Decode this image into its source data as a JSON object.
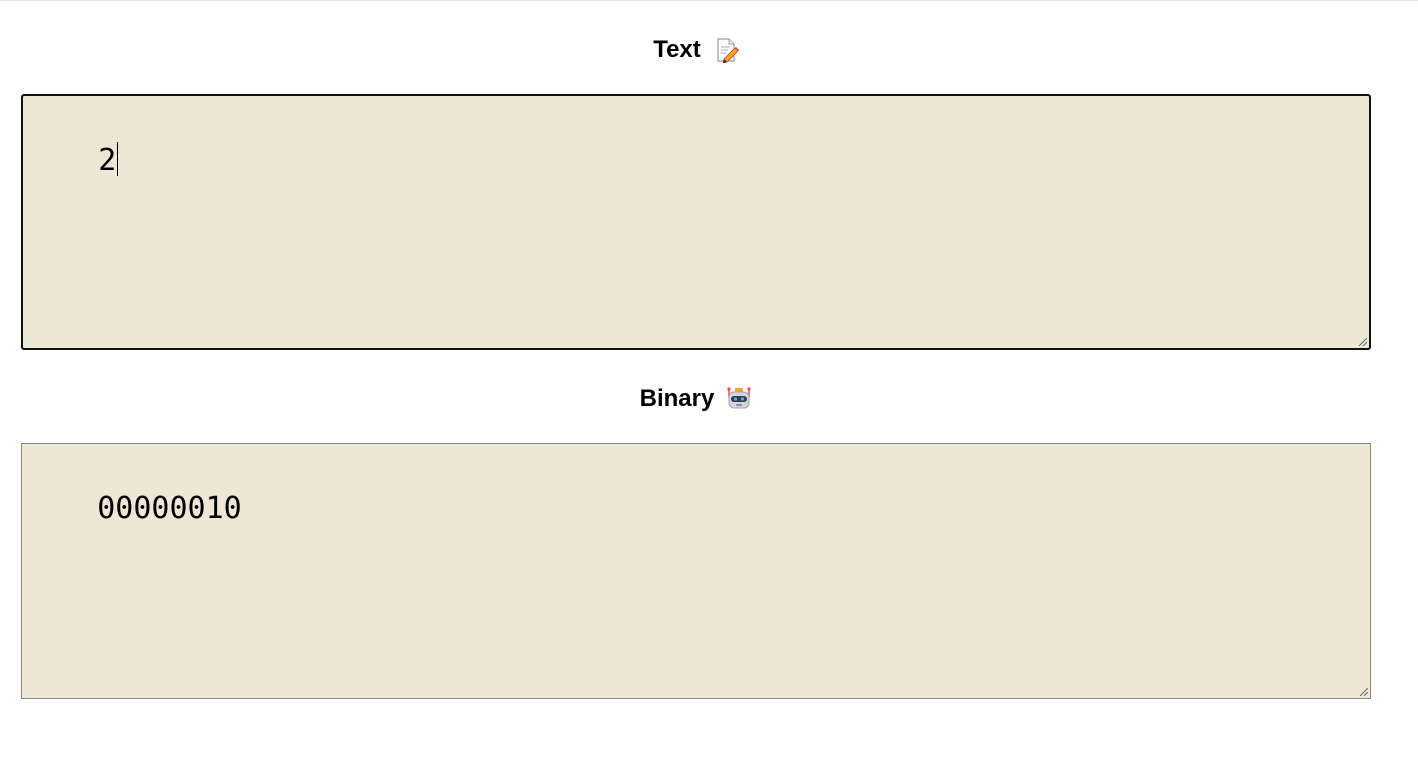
{
  "text_section": {
    "label": "Text",
    "icon": "memo-pencil-icon",
    "value": "2"
  },
  "binary_section": {
    "label": "Binary",
    "icon": "robot-icon",
    "value": "00000010"
  },
  "colors": {
    "panel_background": "#efe7d5",
    "focused_border": "#111111",
    "unfocused_border": "#8a8a8a"
  }
}
